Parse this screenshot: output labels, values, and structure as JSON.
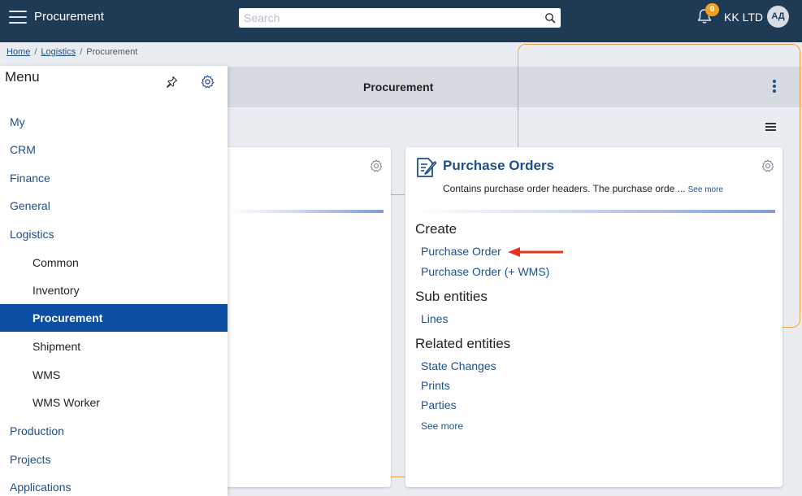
{
  "topbar": {
    "title": "Procurement",
    "search_placeholder": "Search",
    "notification_count": "0",
    "company": "KK LTD",
    "avatar_initials": "АД"
  },
  "breadcrumb": {
    "items": [
      "Home",
      "Logistics",
      "Procurement"
    ],
    "separator": "/"
  },
  "page": {
    "title": "Procurement"
  },
  "menu": {
    "title": "Menu",
    "items": [
      {
        "label": "My",
        "level": "top"
      },
      {
        "label": "CRM",
        "level": "top"
      },
      {
        "label": "Finance",
        "level": "top"
      },
      {
        "label": "General",
        "level": "top"
      },
      {
        "label": "Logistics",
        "level": "top"
      },
      {
        "label": "Common",
        "level": "sub"
      },
      {
        "label": "Inventory",
        "level": "sub"
      },
      {
        "label": "Procurement",
        "level": "sub",
        "active": true
      },
      {
        "label": "Shipment",
        "level": "sub"
      },
      {
        "label": "WMS",
        "level": "sub"
      },
      {
        "label": "WMS Worker",
        "level": "sub"
      },
      {
        "label": "Production",
        "level": "top"
      },
      {
        "label": "Projects",
        "level": "top"
      },
      {
        "label": "Applications",
        "level": "top"
      }
    ]
  },
  "card": {
    "title": "Purchase Orders",
    "description": "Contains purchase order headers. The purchase orde ...",
    "see_more_inline": "See more",
    "create_heading": "Create",
    "create_links": [
      "Purchase Order",
      "Purchase Order (+ WMS)"
    ],
    "sub_heading": "Sub entities",
    "sub_links": [
      "Lines"
    ],
    "related_heading": "Related entities",
    "related_links": [
      "State Changes",
      "Prints",
      "Parties"
    ],
    "see_more": "See more"
  },
  "colors": {
    "topbar": "#1f3a55",
    "link": "#1e4f8a",
    "active_menu": "#0b4ea2",
    "highlight": "#f0a24a",
    "arrow": "#e8321e"
  }
}
